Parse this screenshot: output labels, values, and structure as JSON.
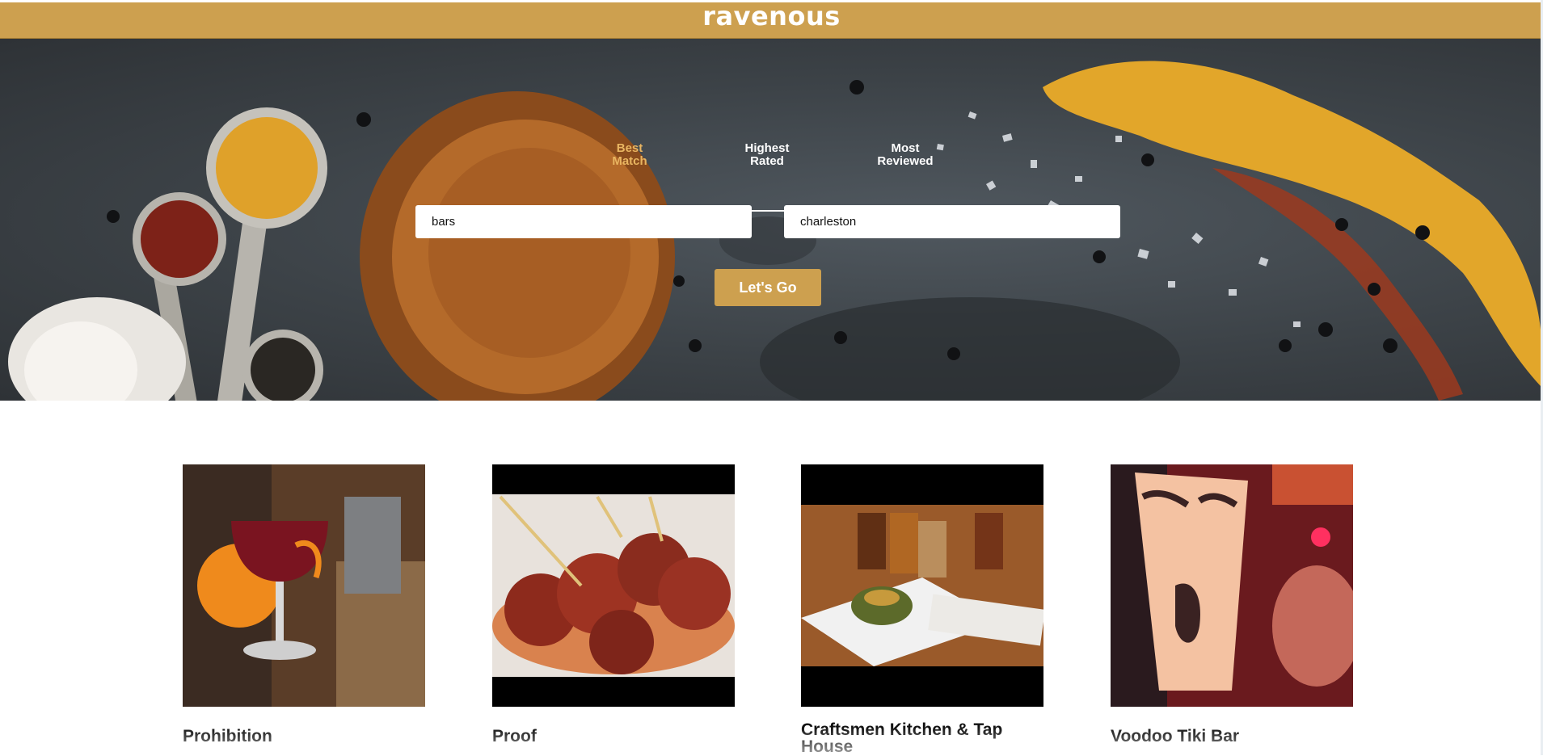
{
  "header": {
    "logo": "ravenous",
    "color": "#cda04f"
  },
  "hero": {
    "background_image": "spoons-and-spices-on-slate",
    "sort_tabs": [
      {
        "label_line1": "Best",
        "label_line2": "Match",
        "active": true
      },
      {
        "label_line1": "Highest",
        "label_line2": "Rated",
        "active": false
      },
      {
        "label_line1": "Most",
        "label_line2": "Reviewed",
        "active": false
      }
    ],
    "active_tab_color": "#e9b561",
    "search": {
      "term_value": "bars",
      "location_value": "charleston"
    },
    "submit_label": "Let's Go"
  },
  "businesses": [
    {
      "name": "Prohibition",
      "photo": "cocktail-with-orange-peel"
    },
    {
      "name": "Proof",
      "photo": "meatballs-on-skewers"
    },
    {
      "name": "Craftsmen Kitchen & Tap House",
      "photo": "plated-dish-with-beer-flights"
    },
    {
      "name": "Voodoo Tiki Bar",
      "photo": "tiki-mug-drinks"
    }
  ]
}
